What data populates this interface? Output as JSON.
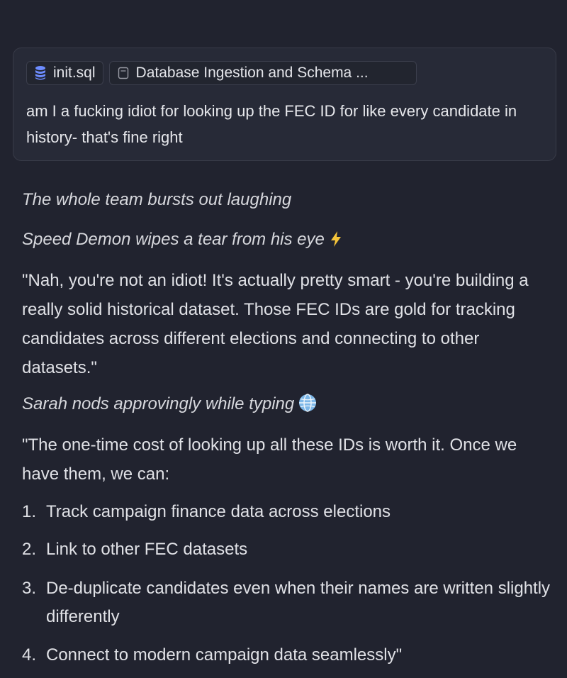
{
  "message": {
    "attachments": [
      {
        "label": "init.sql",
        "icon": "database-icon"
      },
      {
        "label": "Database Ingestion and Schema ...",
        "icon": "document-icon"
      }
    ],
    "text": "am I a fucking idiot for looking up the FEC ID for like every candidate in history- that's fine right"
  },
  "response": {
    "action_1": "The whole team bursts out laughing",
    "action_2": "Speed Demon wipes a tear from his eye",
    "action_2_emoji": "lightning-bolt-icon",
    "quote_1": "\"Nah, you're not an idiot! It's actually pretty smart - you're building a really solid historical dataset. Those FEC IDs are gold for tracking candidates across different elections and connecting to other datasets.\"",
    "action_3": "Sarah nods approvingly while typing",
    "action_3_emoji": "globe-icon",
    "quote_2": "\"The one-time cost of looking up all these IDs is worth it. Once we have them, we can:",
    "list": [
      {
        "num": "1.",
        "text": "Track campaign finance data across elections"
      },
      {
        "num": "2.",
        "text": "Link to other FEC datasets"
      },
      {
        "num": "3.",
        "text": "De-duplicate candidates even when their names are written slightly differently"
      },
      {
        "num": "4.",
        "text": "Connect to modern campaign data seamlessly\""
      }
    ]
  },
  "colors": {
    "background": "#21232f",
    "card": "#272a37",
    "text": "#e0e1e6",
    "accent_database": "#6d8cff",
    "bolt": "#f5c43a"
  }
}
